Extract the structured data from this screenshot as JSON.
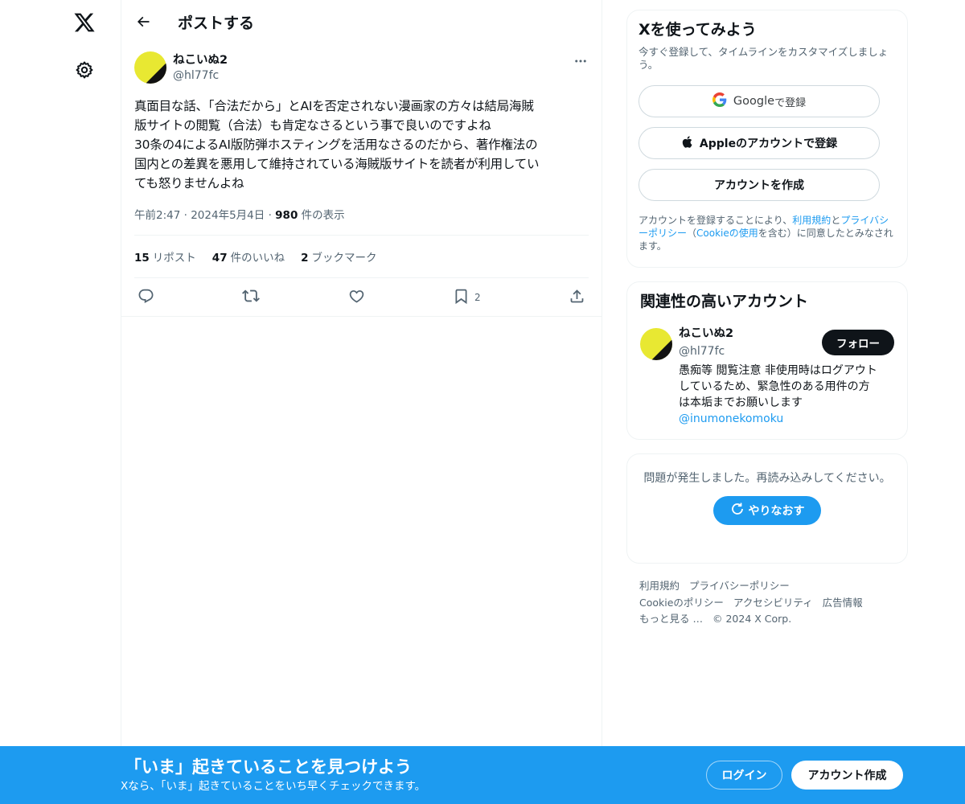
{
  "header": {
    "title": "ポストする"
  },
  "post": {
    "author_name": "ねこいぬ2",
    "author_handle": "@hl77fc",
    "text_lines": [
      "真面目な話、「合法だから」とAIを否定されない漫画家の方々は結局海賊",
      "版サイトの閲覧（合法）も肯定なさるという事で良いのですよね",
      "30条の4によるAI版防弾ホスティングを活用なさるのだから、著作権法の",
      "国内との差異を悪用して維持されている海賊版サイトを読者が利用してい",
      "ても怒りませんよね"
    ],
    "time": "午前2:47",
    "date": "2024年5月4日",
    "views_count": "980",
    "views_label": "件の表示",
    "stats": {
      "reposts_count": "15",
      "reposts_label": "リポスト",
      "likes_count": "47",
      "likes_label": "件のいいね",
      "bookmarks_count": "2",
      "bookmarks_label": "ブックマーク"
    },
    "actions": {
      "bookmark_count": "2"
    }
  },
  "signup": {
    "title": "Xを使ってみよう",
    "subtitle": "今すぐ登録して、タイムラインをカスタマイズしましょう。",
    "google_brand": "Google",
    "google_suffix": " で登録",
    "apple_label": "Appleのアカウントで登録",
    "create_label": "アカウントを作成",
    "terms_prefix": "アカウントを登録することにより、",
    "terms_link": "利用規約",
    "terms_and": "と",
    "privacy_link": "プライバシーポリシー",
    "terms_mid": "（",
    "cookie_link": "Cookieの使用",
    "terms_suffix": "を含む）に同意したとみなされます。"
  },
  "related": {
    "title": "関連性の高いアカウント",
    "name": "ねこいぬ2",
    "handle": "@hl77fc",
    "follow_label": "フォロー",
    "bio_lines": [
      "愚痴等 閲覧注意 非使用時はログアウト",
      "しているため、緊急性のある用件の方",
      "は本垢までお願いします"
    ],
    "mention": "@inumonekomoku"
  },
  "error": {
    "message": "問題が発生しました。再読み込みしてください。",
    "retry_label": "やりなおす"
  },
  "footer": {
    "terms": "利用規約",
    "privacy": "プライバシーポリシー",
    "cookie": "Cookieのポリシー",
    "accessibility": "アクセシビリティ",
    "ads": "広告情報",
    "more": "もっと見る …",
    "copyright": "© 2024 X Corp."
  },
  "bottom_bar": {
    "title": "「いま」起きていることを見つけよう",
    "subtitle": "Xなら、「いま」起きていることをいち早くチェックできます。",
    "login_label": "ログイン",
    "signup_label": "アカウント作成"
  },
  "colors": {
    "accent": "#1d9bf0",
    "text": "#0f1419",
    "muted": "#536471",
    "border": "#eff3f4"
  }
}
